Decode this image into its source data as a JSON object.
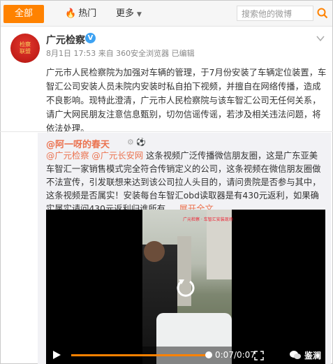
{
  "nav": {
    "tabs": [
      "全部",
      "热门",
      "更多"
    ],
    "search_placeholder": "搜索他的微博"
  },
  "post": {
    "author": "广元检察",
    "avatar_text": "检察 联盟",
    "verified": "V",
    "meta": "8月1日 17:53 来自 360安全浏览器  已编辑",
    "text": "广元市人民检察院为加强对车辆的管理，于7月份安装了车辆定位装置，车智汇公司安装人员未院内安装时私自拍下视频，并擅自在网络传播，造成不良影响。现特此澄清，广元市人民检察院与该车智汇公司无任何关系，请广大网民朋友注意信息甄别，切勿信谣传谣，若涉及相关违法问题，将依法处理。"
  },
  "repost": {
    "author": "@阿一呀的春天",
    "mention_1": "@广元检察",
    "mention_2": "@广元长安网",
    "text": " 这条视频广泛传播微信朋友圈，这是广东亚美车智汇一家销售模式完全符合传销定义的公司，这条视频在微信朋友圈做不法宣传，引发联想来达到该公司拉人头目的，请问贵院是否参与其中，这条视频是否属实！安装每台车智汇obd读取器是有430元返利，如果确实属实请问430元返利归谁所有 ...",
    "expand": "展开全文",
    "expand_caret": "⌄"
  },
  "video": {
    "caption": "广元检察 · 车智汇安装现场",
    "time": "0:07/0:07",
    "progress": 1.0,
    "watermark": "鉴澜"
  },
  "colors": {
    "accent": "#ff8200",
    "link": "#eb7350",
    "verified": "#3da2f2"
  }
}
